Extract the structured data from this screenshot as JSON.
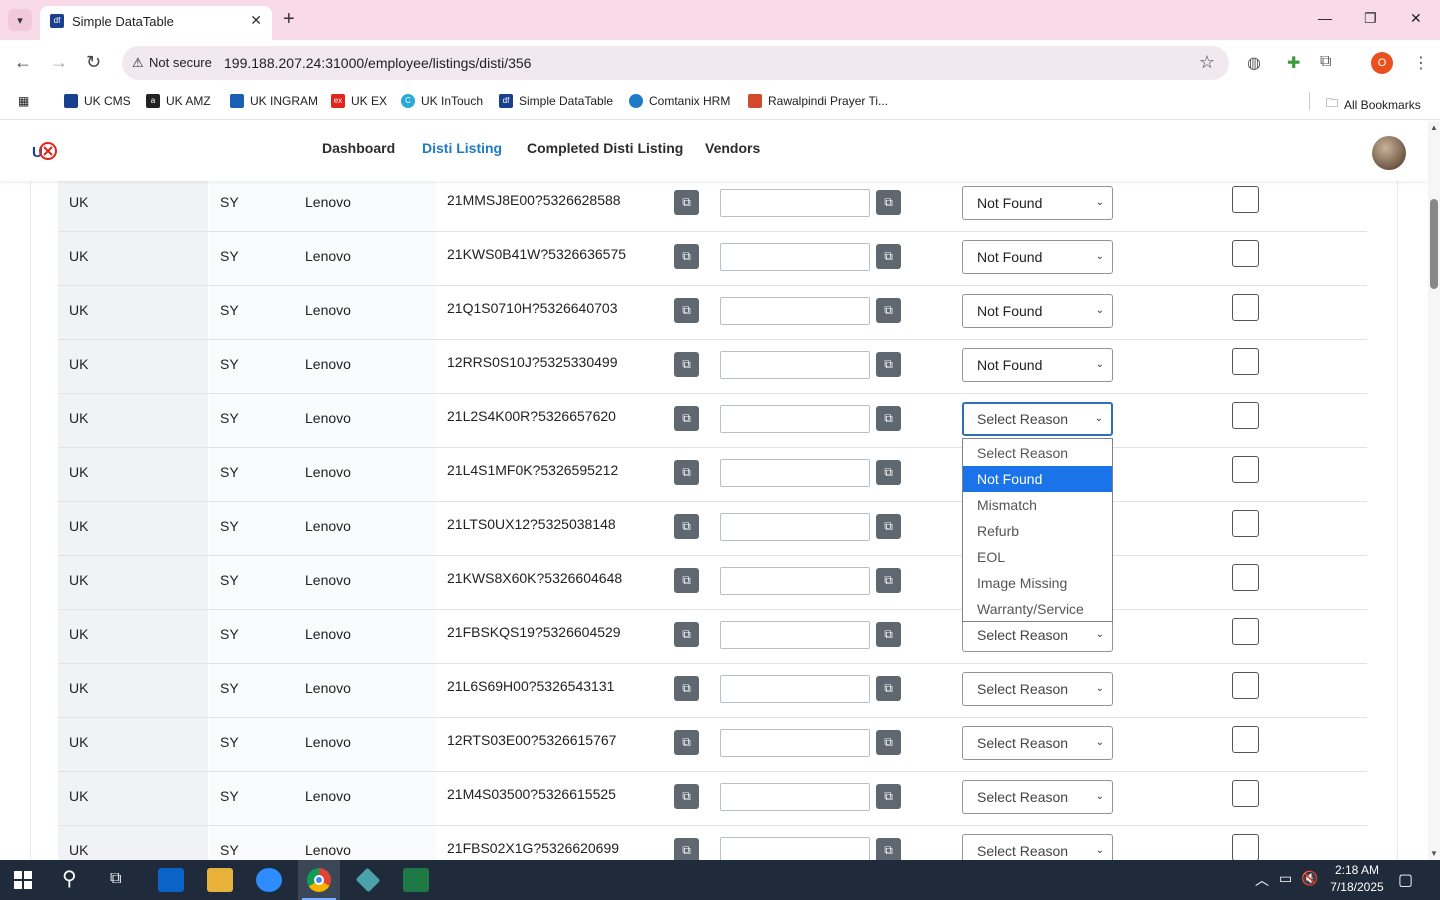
{
  "browser": {
    "tab_title": "Simple DataTable",
    "new_tab": "+",
    "address": {
      "security_label": "Not secure",
      "url": "199.188.207.24:31000/employee/listings/disti/356"
    },
    "bookmarks": [
      {
        "label": "UK CMS",
        "icon_color": "#1b3f8f"
      },
      {
        "label": "UK AMZ",
        "icon_color": "#222222"
      },
      {
        "label": "UK INGRAM",
        "icon_color": "#1a5fb4"
      },
      {
        "label": "UK EX",
        "icon_color": "#e1251b"
      },
      {
        "label": "UK InTouch",
        "icon_color": "#2aa9d8"
      },
      {
        "label": "Simple DataTable",
        "icon_color": "#1b3f8f"
      },
      {
        "label": "Comtanix HRM",
        "icon_color": "#1f7ac8"
      },
      {
        "label": "Rawalpindi Prayer Ti...",
        "icon_color": "#d04a2b"
      }
    ],
    "all_bookmarks": "All Bookmarks",
    "profile_initial": "O"
  },
  "app": {
    "nav": [
      {
        "label": "Dashboard",
        "active": false
      },
      {
        "label": "Disti Listing",
        "active": true
      },
      {
        "label": "Completed Disti Listing",
        "active": false
      },
      {
        "label": "Vendors",
        "active": false
      }
    ],
    "accent_color": "#1f7ac8"
  },
  "table": {
    "rows": [
      {
        "country": "UK",
        "code": "SY",
        "brand": "Lenovo",
        "sku": "21MMSJ8E00?5326628588",
        "reason": "Not Found"
      },
      {
        "country": "UK",
        "code": "SY",
        "brand": "Lenovo",
        "sku": "21KWS0B41W?5326636575",
        "reason": "Not Found"
      },
      {
        "country": "UK",
        "code": "SY",
        "brand": "Lenovo",
        "sku": "21Q1S0710H?5326640703",
        "reason": "Not Found"
      },
      {
        "country": "UK",
        "code": "SY",
        "brand": "Lenovo",
        "sku": "12RRS0S10J?5325330499",
        "reason": "Not Found"
      },
      {
        "country": "UK",
        "code": "SY",
        "brand": "Lenovo",
        "sku": "21L2S4K00R?5326657620",
        "reason": "Select Reason"
      },
      {
        "country": "UK",
        "code": "SY",
        "brand": "Lenovo",
        "sku": "21L4S1MF0K?5326595212",
        "reason": ""
      },
      {
        "country": "UK",
        "code": "SY",
        "brand": "Lenovo",
        "sku": "21LTS0UX12?5325038148",
        "reason": ""
      },
      {
        "country": "UK",
        "code": "SY",
        "brand": "Lenovo",
        "sku": "21KWS8X60K?5326604648",
        "reason": ""
      },
      {
        "country": "UK",
        "code": "SY",
        "brand": "Lenovo",
        "sku": "21FBSKQS19?5326604529",
        "reason": "Select Reason"
      },
      {
        "country": "UK",
        "code": "SY",
        "brand": "Lenovo",
        "sku": "21L6S69H00?5326543131",
        "reason": "Select Reason"
      },
      {
        "country": "UK",
        "code": "SY",
        "brand": "Lenovo",
        "sku": "12RTS03E00?5326615767",
        "reason": "Select Reason"
      },
      {
        "country": "UK",
        "code": "SY",
        "brand": "Lenovo",
        "sku": "21M4S03500?5326615525",
        "reason": "Select Reason"
      },
      {
        "country": "UK",
        "code": "SY",
        "brand": "Lenovo",
        "sku": "21FBS02X1G?5326620699",
        "reason": "Select Reason"
      }
    ],
    "open_dropdown_options": [
      "Select Reason",
      "Not Found",
      "Mismatch",
      "Refurb",
      "EOL",
      "Image Missing",
      "Warranty/Service"
    ],
    "highlighted_option": "Not Found"
  },
  "taskbar": {
    "time": "2:18 AM",
    "date": "7/18/2025"
  }
}
